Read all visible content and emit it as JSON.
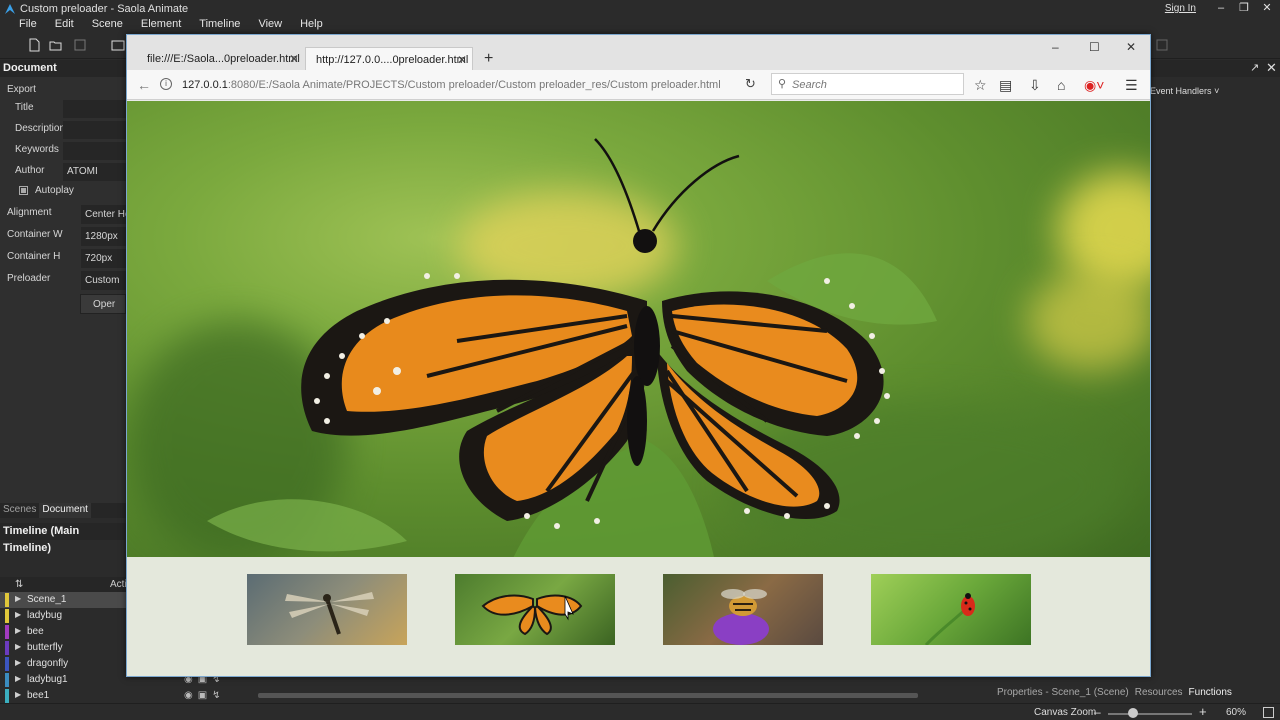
{
  "app": {
    "title": "Custom preloader - Saola Animate",
    "sign_in": "Sign In"
  },
  "menu": [
    "File",
    "Edit",
    "Scene",
    "Element",
    "Timeline",
    "View",
    "Help"
  ],
  "document_panel": {
    "header": "Document",
    "export_label": "Export",
    "title_label": "Title",
    "description_label": "Description",
    "keywords_label": "Keywords",
    "author_label": "Author",
    "author_value": "ATOMI",
    "autoplay_label": "Autoplay",
    "alignment_label": "Alignment",
    "alignment_value": "Center Hor",
    "container_w_label": "Container W",
    "container_w_value": "1280px",
    "container_h_label": "Container H",
    "container_h_value": "720px",
    "preloader_label": "Preloader",
    "preloader_value": "Custom",
    "open_button": "Oper"
  },
  "left_tabs": [
    "Scenes",
    "Document"
  ],
  "timeline": {
    "header": "Timeline (Main Timeline)",
    "actions_label": "Acti",
    "layers": [
      {
        "name": "Scene_1",
        "color": "#e0c73a",
        "selected": true
      },
      {
        "name": "ladybug",
        "color": "#e0c73a"
      },
      {
        "name": "bee",
        "color": "#a23bbf"
      },
      {
        "name": "butterfly",
        "color": "#6b3bbf"
      },
      {
        "name": "dragonfly",
        "color": "#3b55bf"
      },
      {
        "name": "ladybug1",
        "color": "#3b8dbf"
      },
      {
        "name": "bee1",
        "color": "#3bafbf"
      }
    ]
  },
  "right_panel": {
    "event_handlers": "Event Handlers",
    "tabs": [
      "Properties - Scene_1 (Scene)",
      "Resources",
      "Functions"
    ]
  },
  "status": {
    "canvas_zoom_label": "Canvas Zoom",
    "zoom_value": "60%",
    "zoom_fraction": 0.3
  },
  "browser": {
    "tabs": [
      {
        "title": "file:///E:/Saola...0preloader.html",
        "active": false
      },
      {
        "title": "http://127.0.0....0preloader.html",
        "active": true
      }
    ],
    "url_host": "127.0.0.1",
    "url_rest": ":8080/E:/Saola Animate/PROJECTS/Custom preloader/Custom preloader_res/Custom preloader.html",
    "search_placeholder": "Search"
  },
  "thumbnails": [
    "dragonfly",
    "butterfly",
    "bee",
    "ladybug"
  ]
}
